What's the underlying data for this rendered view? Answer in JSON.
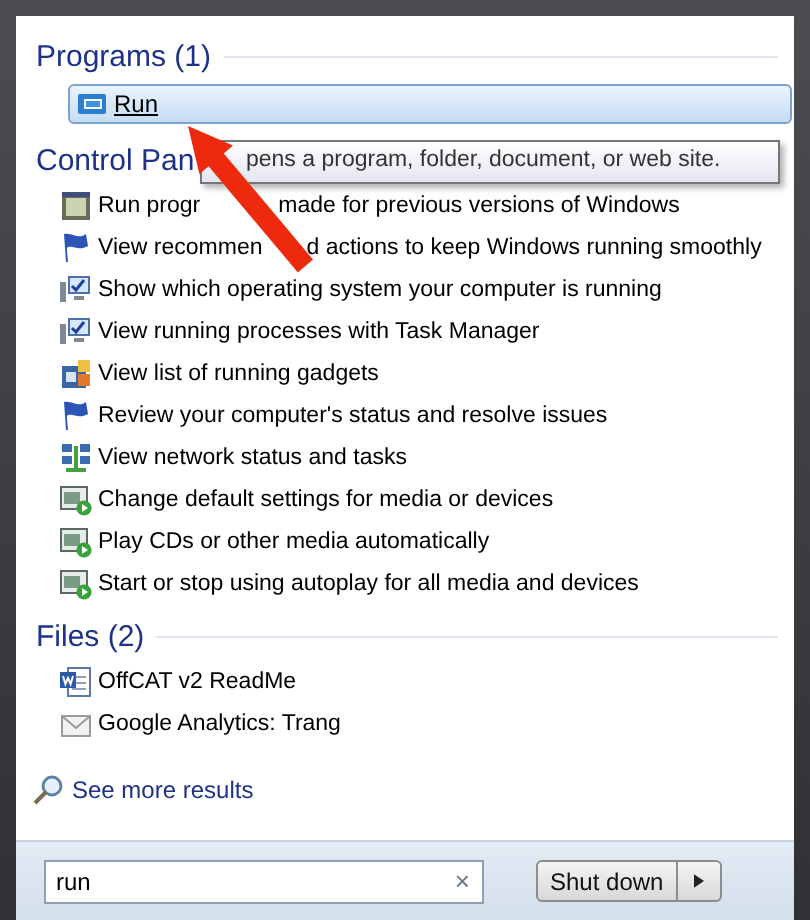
{
  "programs": {
    "heading": "Programs (1)",
    "items": [
      {
        "label": "Run",
        "kind": "run",
        "selected": true
      }
    ]
  },
  "tooltip": {
    "text": "pens a program, folder, document, or web site."
  },
  "control_panel": {
    "heading": "Control Pan",
    "items": [
      {
        "parts": [
          "Run progr",
          "made for previous versions of Windows"
        ],
        "kind": "compat"
      },
      {
        "parts": [
          "View recommen",
          "d actions to keep Windows running smoothly"
        ],
        "kind": "flag"
      },
      {
        "parts": [
          "Show which operating system your computer is running"
        ],
        "kind": "monitor"
      },
      {
        "parts": [
          "View running processes with Task Manager"
        ],
        "kind": "monitor"
      },
      {
        "parts": [
          "View list of running gadgets"
        ],
        "kind": "gadgets"
      },
      {
        "parts": [
          "Review your computer's status and resolve issues"
        ],
        "kind": "flag"
      },
      {
        "parts": [
          "View network status and tasks"
        ],
        "kind": "network"
      },
      {
        "parts": [
          "Change default settings for media or devices"
        ],
        "kind": "media"
      },
      {
        "parts": [
          "Play CDs or other media automatically"
        ],
        "kind": "media"
      },
      {
        "parts": [
          "Start or stop using autoplay for all media and devices"
        ],
        "kind": "media"
      }
    ]
  },
  "files": {
    "heading": "Files (2)",
    "items": [
      {
        "label": "OffCAT v2 ReadMe",
        "kind": "word"
      },
      {
        "label": "Google Analytics: Trang",
        "kind": "mail"
      }
    ]
  },
  "see_more": "See more results",
  "search": {
    "value": "run",
    "clear": "×"
  },
  "shut_down": {
    "label": "Shut down"
  }
}
